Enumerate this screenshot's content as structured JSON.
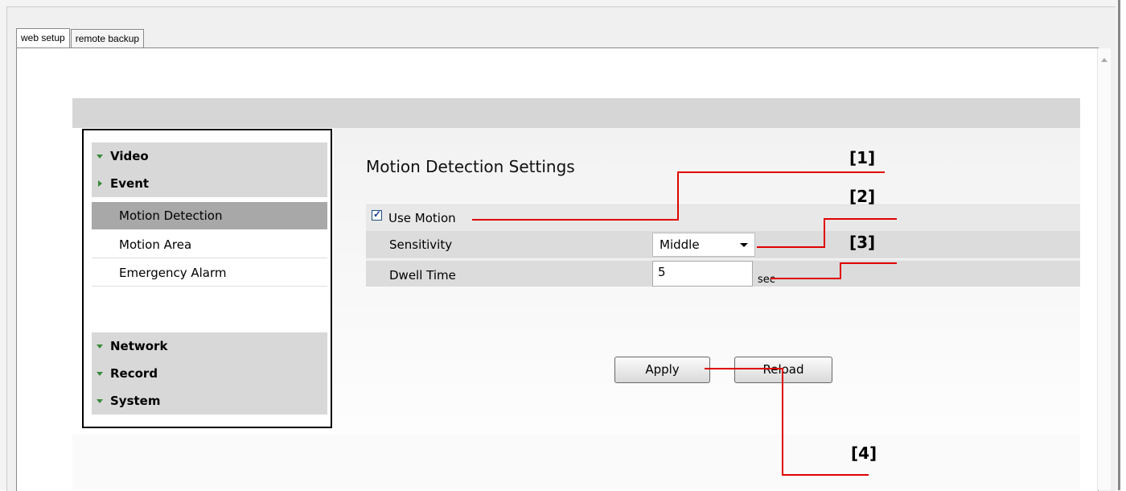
{
  "tabs": [
    "web setup",
    "remote backup"
  ],
  "sidebar": {
    "top_groups": [
      {
        "label": "Video",
        "expanded": true
      },
      {
        "label": "Event",
        "expanded": false
      }
    ],
    "items": [
      "Motion Detection",
      "Motion Area",
      "Emergency Alarm"
    ],
    "active_item": "Motion Detection",
    "bottom_groups": [
      "Network",
      "Record",
      "System"
    ]
  },
  "main": {
    "title": "Motion Detection Settings",
    "use_motion": {
      "label": "Use Motion",
      "checked": true
    },
    "sensitivity": {
      "label": "Sensitivity",
      "value": "Middle"
    },
    "dwell_time": {
      "label": "Dwell Time",
      "value": "5",
      "unit": "sec"
    },
    "apply_label": "Apply",
    "reload_label": "Reload"
  },
  "annotations": [
    "[1]",
    "[2]",
    "[3]",
    "[4]"
  ],
  "colors": {
    "annotation_line": "#e00000",
    "active_item": "#a8a8a8",
    "group_arrow": "#3a8a3a"
  }
}
